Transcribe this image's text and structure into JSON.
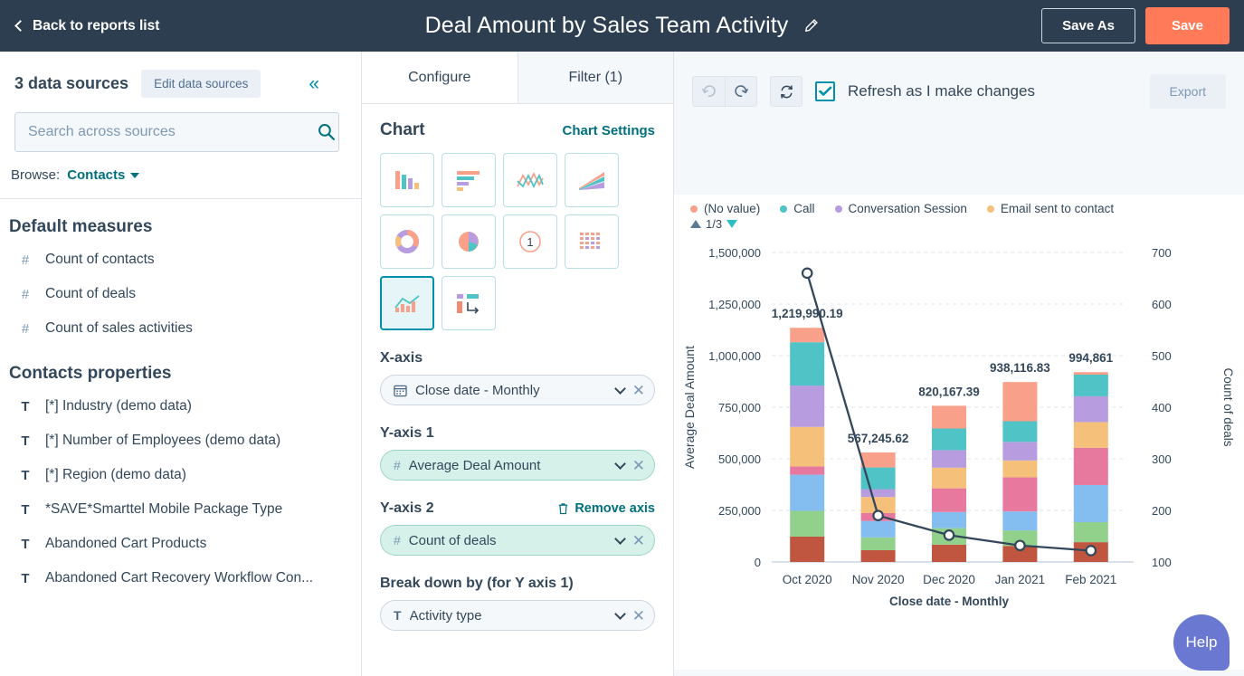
{
  "topbar": {
    "back_label": "Back to reports list",
    "title": "Deal Amount by Sales Team Activity",
    "edit_icon": "pencil-icon",
    "save_as_label": "Save As",
    "save_label": "Save",
    "bg": "#2d3e50",
    "save_color": "#ff7a59"
  },
  "sidebar": {
    "data_sources_count": "3 data sources",
    "edit_data_sources_label": "Edit data sources",
    "collapse_icon": "double-chevron-left-icon",
    "search": {
      "value": "",
      "placeholder": "Search across sources",
      "icon": "search-icon"
    },
    "browse_label": "Browse:",
    "browse_value": "Contacts",
    "sections": [
      {
        "title": "Default measures",
        "fields": [
          {
            "icon": "#",
            "label": "Count of contacts"
          },
          {
            "icon": "#",
            "label": "Count of deals"
          },
          {
            "icon": "#",
            "label": "Count of sales activities"
          }
        ]
      },
      {
        "title": "Contacts properties",
        "fields": [
          {
            "icon": "T",
            "label": "[*] Industry (demo data)"
          },
          {
            "icon": "T",
            "label": "[*] Number of Employees (demo data)"
          },
          {
            "icon": "T",
            "label": "[*] Region (demo data)"
          },
          {
            "icon": "T",
            "label": "*SAVE*Smarttel Mobile Package Type"
          },
          {
            "icon": "T",
            "label": "Abandoned Cart Products"
          },
          {
            "icon": "T",
            "label": "Abandoned Cart Recovery Workflow Con..."
          }
        ]
      }
    ]
  },
  "configure": {
    "tabs": [
      {
        "label": "Configure",
        "active": true
      },
      {
        "label": "Filter (1)",
        "active": false
      }
    ],
    "chart_heading": "Chart",
    "chart_settings_link": "Chart Settings",
    "chart_types": [
      {
        "name": "vertical-bar-chart-icon",
        "selected": false
      },
      {
        "name": "horizontal-bar-chart-icon",
        "selected": false
      },
      {
        "name": "line-chart-icon",
        "selected": false
      },
      {
        "name": "area-chart-icon",
        "selected": false
      },
      {
        "name": "donut-chart-icon",
        "selected": false
      },
      {
        "name": "pie-chart-icon",
        "selected": false
      },
      {
        "name": "single-value-icon",
        "selected": false
      },
      {
        "name": "table-chart-icon",
        "selected": false
      },
      {
        "name": "combo-chart-icon",
        "selected": true
      },
      {
        "name": "pivot-table-icon",
        "selected": false
      }
    ],
    "x_axis": {
      "label": "X-axis",
      "field": "Close date - Monthly",
      "icon": "calendar-icon"
    },
    "y_axis_1": {
      "label": "Y-axis 1",
      "field": "Average Deal Amount",
      "icon": "#"
    },
    "y_axis_2": {
      "label": "Y-axis 2",
      "field": "Count of deals",
      "icon": "#",
      "remove_label": "Remove axis",
      "remove_icon": "trash-icon"
    },
    "break_down": {
      "label": "Break down by (for Y axis 1)",
      "field": "Activity type",
      "icon": "T"
    }
  },
  "toolbar": {
    "undo_icon": "undo-icon",
    "redo_icon": "redo-icon",
    "refresh_icon": "refresh-icon",
    "refresh_checked": true,
    "refresh_label": "Refresh as I make changes",
    "export_label": "Export"
  },
  "help": {
    "label": "Help",
    "color": "#6a78d1"
  },
  "chart_data": {
    "type": "bar",
    "subtype": "stacked-bar-with-line-combo",
    "title": "",
    "xlabel": "Close date - Monthly",
    "ylabel": "Average Deal Amount",
    "y2label": "Count of deals",
    "categories": [
      "Oct 2020",
      "Nov 2020",
      "Dec 2020",
      "Jan 2021",
      "Feb 2021"
    ],
    "ylim": [
      0,
      1500000
    ],
    "yticks": [
      "0",
      "250,000",
      "500,000",
      "750,000",
      "1,000,000",
      "1,250,000",
      "1,500,000"
    ],
    "y2lim": [
      100,
      700
    ],
    "y2ticks": [
      "100",
      "200",
      "300",
      "400",
      "500",
      "600",
      "700"
    ],
    "grid": true,
    "legend_position": "top",
    "legend": [
      {
        "label": "(No value)",
        "color": "#f8a08a"
      },
      {
        "label": "Call",
        "color": "#4fc3c5"
      },
      {
        "label": "Conversation Session",
        "color": "#b79ce0"
      },
      {
        "label": "Email sent to contact",
        "color": "#f4c07a"
      }
    ],
    "legend_pager": "1/3",
    "bar_totals": [
      "1,219,990.19",
      "567,245.62",
      "820,167.39",
      "938,116.83",
      "994,861"
    ],
    "bar_total_values": [
      1219990.19,
      567245.62,
      820167.39,
      938116.83,
      994861
    ],
    "stack_colors": [
      "#c0563f",
      "#92d18b",
      "#84bdf0",
      "#e8799e",
      "#f4c07a",
      "#b79ce0",
      "#4fc3c5",
      "#f8a08a"
    ],
    "stack_series": [
      {
        "name": "segment-1",
        "color": "#c0563f",
        "values": [
          123000,
          57000,
          84000,
          78000,
          96000
        ]
      },
      {
        "name": "segment-2",
        "color": "#92d18b",
        "values": [
          125000,
          62000,
          80000,
          75000,
          97000
        ]
      },
      {
        "name": "segment-3",
        "color": "#84bdf0",
        "values": [
          175000,
          80000,
          78000,
          92000,
          180000
        ]
      },
      {
        "name": "segment-4",
        "color": "#e8799e",
        "values": [
          40000,
          38000,
          115000,
          165000,
          180000
        ]
      },
      {
        "name": "segment-5",
        "color": "#f4c07a",
        "values": [
          192000,
          78000,
          100000,
          82000,
          125000
        ]
      },
      {
        "name": "segment-6",
        "color": "#b79ce0",
        "values": [
          200000,
          38000,
          85000,
          90000,
          125000
        ]
      },
      {
        "name": "segment-7",
        "color": "#4fc3c5",
        "values": [
          210000,
          105000,
          105000,
          100000,
          105000
        ]
      },
      {
        "name": "segment-8",
        "color": "#f8a08a",
        "values": [
          70000,
          73000,
          110000,
          190000,
          12000
        ]
      }
    ],
    "line_series": {
      "name": "Count of deals",
      "color": "#33475b",
      "values": [
        660,
        190,
        152,
        132,
        122
      ]
    }
  }
}
